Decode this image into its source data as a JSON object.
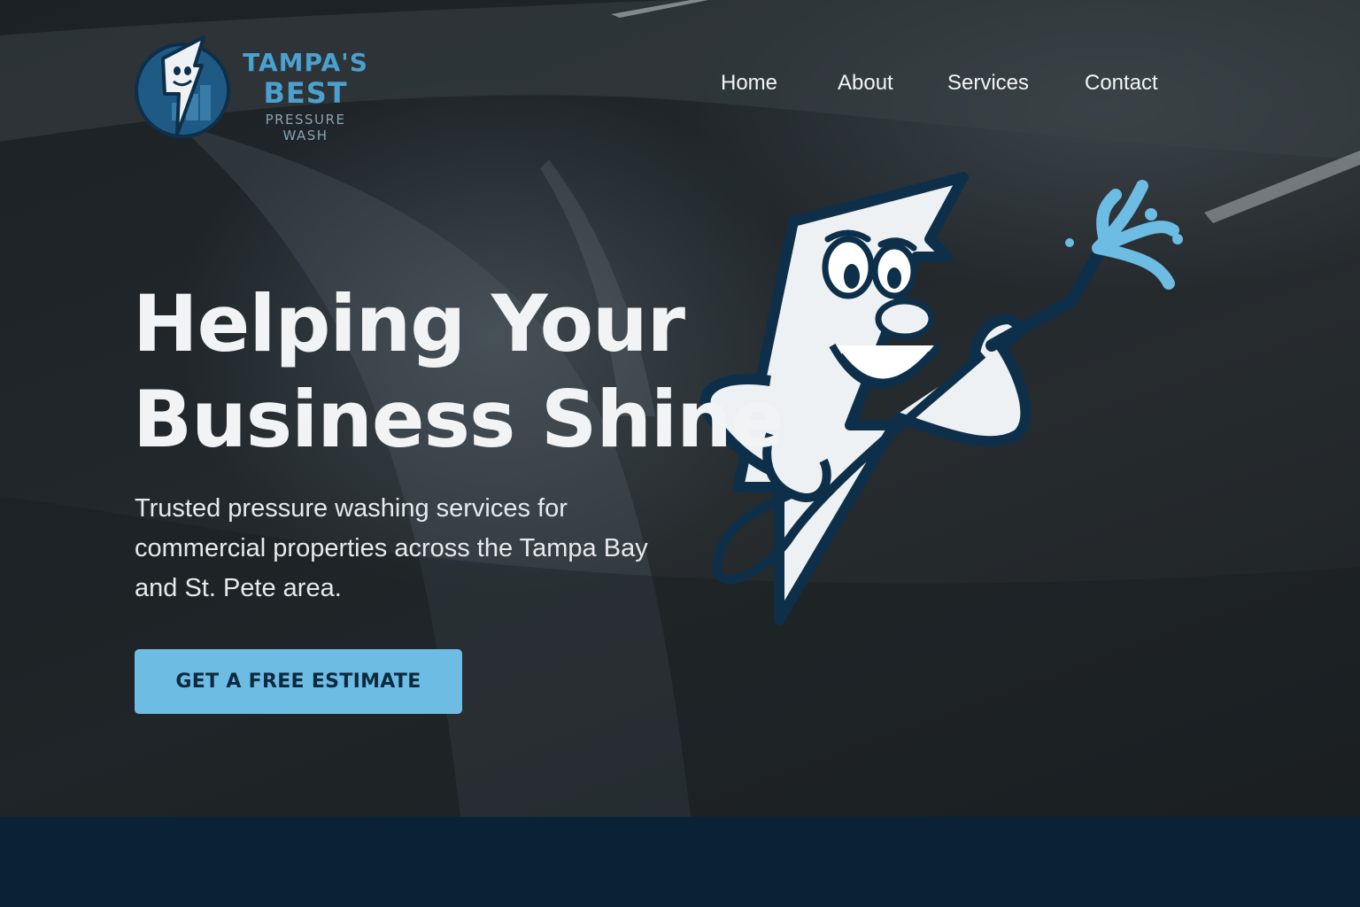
{
  "brand": {
    "line1": "TAMPA'S",
    "line2": "BEST",
    "line3": "PRESSURE WASH",
    "logo_icon": "lightning-mascot-logo-icon"
  },
  "nav": {
    "items": [
      {
        "label": "Home"
      },
      {
        "label": "About"
      },
      {
        "label": "Services"
      },
      {
        "label": "Contact"
      }
    ]
  },
  "hero": {
    "headline_line1": "Helping Your",
    "headline_line2": "Business Shine",
    "subtext": "Trusted pressure washing services for commercial properties across the Tampa Bay and St. Pete area.",
    "cta_label": "GET A FREE ESTIMATE",
    "mascot_icon": "lightning-bolt-mascot-icon"
  },
  "colors": {
    "accent": "#6cbce4",
    "brand_blue": "#4aa0cf",
    "navy": "#0b2136",
    "text": "#f1f3f4"
  }
}
